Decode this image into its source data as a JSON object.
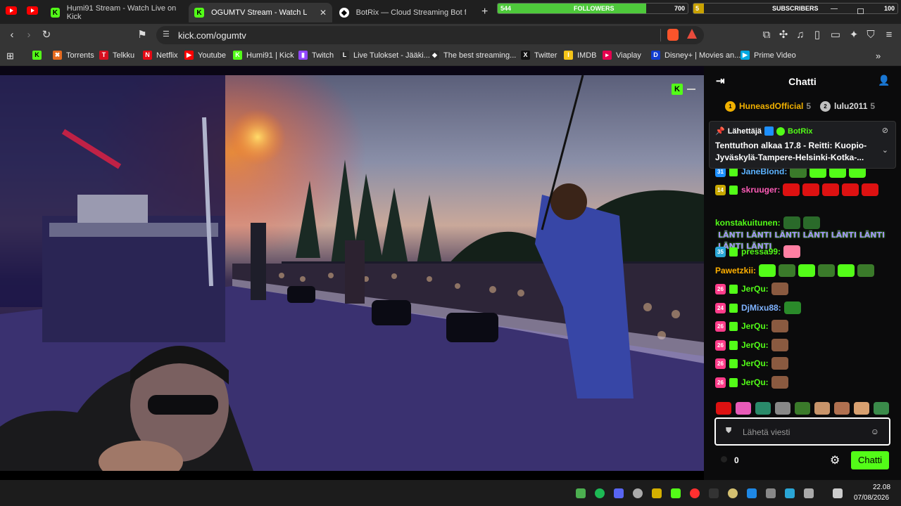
{
  "widgets": {
    "followers_label": "FOLLOWERS",
    "followers_current": "544",
    "followers_goal": "700",
    "followers_progress": 0.78,
    "subscribers_label": "SUBSCRIBERS",
    "subscribers_current": "5",
    "subscribers_goal": "100",
    "subscribers_progress": 0.05
  },
  "tabs": [
    {
      "title": "Humi91 Stream - Watch Live on Kick",
      "icon": "kick-icon"
    },
    {
      "title": "OGUMTV Stream - Watch Live",
      "icon": "kick-icon",
      "close": "✕"
    },
    {
      "title": "BotRix — Cloud Streaming Bot for Tw",
      "icon": "botrix-icon"
    }
  ],
  "address": {
    "url": "kick.com/ogumtv"
  },
  "bookmarks": [
    {
      "label": "Torrents",
      "color": "#e56a1f",
      "glyph": "✖"
    },
    {
      "label": "Telkku",
      "color": "#d60f1f",
      "glyph": "T"
    },
    {
      "label": "Netflix",
      "color": "#e50914",
      "glyph": "N"
    },
    {
      "label": "Youtube",
      "color": "#ff0000",
      "glyph": "▶"
    },
    {
      "label": "Humi91 | Kick",
      "color": "#53fc18",
      "glyph": "K"
    },
    {
      "label": "Twitch",
      "color": "#9146ff",
      "glyph": "▮"
    },
    {
      "label": "Live Tulokset - Jääki...",
      "color": "#2b2b2b",
      "glyph": "L"
    },
    {
      "label": "The best streaming...",
      "color": "#2b2b2b",
      "glyph": "◆"
    },
    {
      "label": "Twitter",
      "color": "#111",
      "glyph": "X"
    },
    {
      "label": "IMDB",
      "color": "#f5c518",
      "glyph": "I"
    },
    {
      "label": "Viaplay",
      "color": "#e5004f",
      "glyph": "▸"
    },
    {
      "label": "Disney+ | Movies an...",
      "color": "#113ccf",
      "glyph": "D"
    },
    {
      "label": "Prime Video",
      "color": "#00a8e1",
      "glyph": "▶"
    }
  ],
  "chat": {
    "title": "Chatti",
    "leaderboard": [
      {
        "rank": "1",
        "name": "HuneasdOfficial",
        "count": "5",
        "color": "#f0b000"
      },
      {
        "rank": "2",
        "name": "lulu2011",
        "count": "5",
        "color": "#c0c0c0"
      }
    ],
    "pinned": {
      "label": "Lähettäjä",
      "user": "BotRix",
      "text": "Tenttuthon alkaa 17.8 - Reitti: Kuopio-Jyväskylä-Tampere-Helsinki-Kotka-..."
    },
    "messages": [
      {
        "badge": "31",
        "badge_color": "#1e90ff",
        "user": "JaneBlond:",
        "color": "#5cb3ff",
        "emotes": [
          "#3a7a2a",
          "#53fc18",
          "#53fc18",
          "#53fc18"
        ]
      },
      {
        "badge": "14",
        "badge_color": "#c8a800",
        "user": "skruuger:",
        "color": "#ff5cb8",
        "emotes": [
          "#d11",
          "#d11",
          "#d11",
          "#d11",
          "#d11"
        ]
      },
      {
        "badge": "",
        "badge_color": "",
        "user": "konstakuitunen:",
        "color": "#53fc18",
        "emotes": [
          "#2a6a2a",
          "#2a6a2a"
        ],
        "text": "LÄNTI LÄNTI LÄNTI LÄNTI LÄNTI LÄNTI LÄNTI LÄNTI"
      },
      {
        "badge": "35",
        "badge_color": "#2aa6d6",
        "user": "pressa99:",
        "color": "#53fc18",
        "emotes": [
          "#ff7fa3"
        ]
      },
      {
        "badge": "",
        "badge_color": "",
        "user": "Pawetzkii:",
        "color": "#ffb000",
        "emotes": [
          "#53fc18",
          "#3a7a2a",
          "#53fc18",
          "#3a7a2a",
          "#53fc18",
          "#3a7a2a"
        ]
      },
      {
        "badge": "26",
        "badge_color": "#ff3c8a",
        "user": "JerQu:",
        "color": "#53fc18",
        "emotes": [
          "#8a5a40"
        ]
      },
      {
        "badge": "24",
        "badge_color": "#ff3c8a",
        "user": "DjMixu88:",
        "color": "#7fb3ff",
        "emotes": [
          "#2a8a2a"
        ]
      },
      {
        "badge": "26",
        "badge_color": "#ff3c8a",
        "user": "JerQu:",
        "color": "#53fc18",
        "emotes": [
          "#8a5a40"
        ]
      },
      {
        "badge": "26",
        "badge_color": "#ff3c8a",
        "user": "JerQu:",
        "color": "#53fc18",
        "emotes": [
          "#8a5a40"
        ]
      },
      {
        "badge": "26",
        "badge_color": "#ff3c8a",
        "user": "JerQu:",
        "color": "#53fc18",
        "emotes": [
          "#8a5a40"
        ]
      },
      {
        "badge": "26",
        "badge_color": "#ff3c8a",
        "user": "JerQu:",
        "color": "#53fc18",
        "emotes": [
          "#8a5a40"
        ]
      }
    ],
    "input_placeholder": "Lähetä viesti",
    "points": "0",
    "send_label": "Chatti"
  },
  "taskbar": {
    "time": "22.08",
    "date": "07/08/2026"
  }
}
